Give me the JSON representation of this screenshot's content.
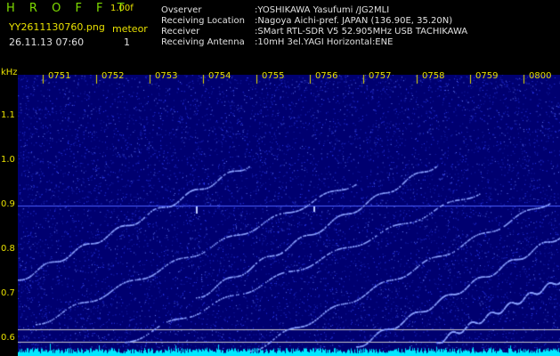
{
  "header": {
    "app_title": "H R O F F T",
    "version": "1.00f",
    "filename": "YY2611130760.png",
    "meteor_label": "meteor",
    "timestamp": "26.11.13 07:60",
    "meteor_count": "1"
  },
  "station_info": {
    "observer_label": "Ovserver",
    "observer_value": ":YOSHIKAWA Yasufumi /JG2MLI",
    "location_label": "Receiving Location",
    "location_value": ":Nagoya Aichi-pref. JAPAN (136.90E, 35.20N)",
    "receiver_label": "Receiver",
    "receiver_value": ":SMart RTL-SDR V5 52.905MHz USB TACHIKAWA",
    "antenna_label": "Receiving Antenna",
    "antenna_value": ":10mH 3el.YAGI Horizontal:ENE"
  },
  "axes": {
    "unit": "kHz",
    "freq_ticks": [
      "1.1",
      "1.0",
      "0.9",
      "0.8",
      "0.7",
      "0.6"
    ],
    "time_ticks": [
      "0751",
      "0752",
      "0753",
      "0754",
      "0755",
      "0756",
      "0757",
      "0758",
      "0759",
      "0800"
    ]
  },
  "colors": {
    "background": "#000000",
    "spectrogram_base": "#000070",
    "noise": "#3040ff",
    "trace": "#8aa0ff",
    "baseline": "#00e8ff",
    "tick": "#e8e000",
    "text_green": "#7fdc00",
    "text_white": "#e0e0e0"
  }
}
